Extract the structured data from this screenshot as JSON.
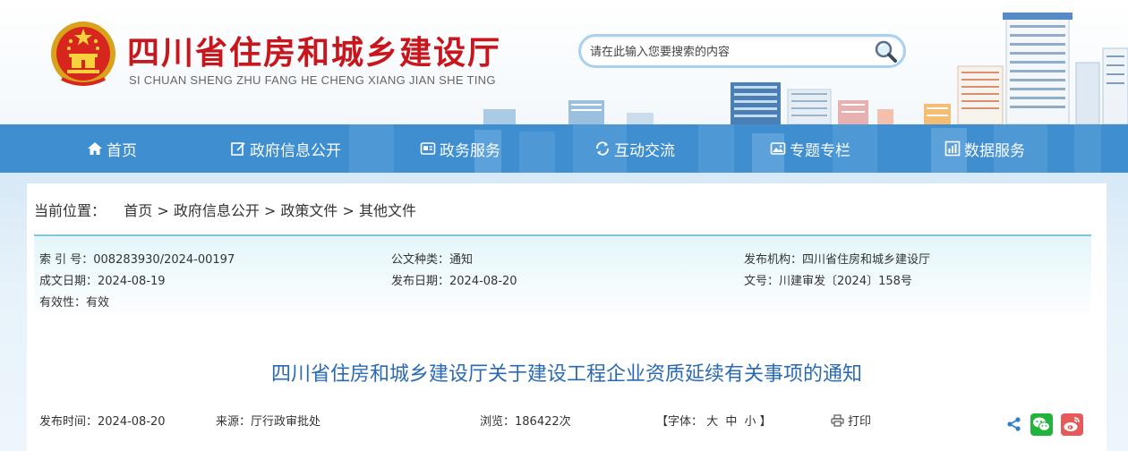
{
  "header": {
    "title": "四川省住房和城乡建设厅",
    "pinyin": "SI CHUAN SHENG ZHU FANG HE CHENG XIANG JIAN SHE TING",
    "search_placeholder": "请在此输入您要搜索的内容"
  },
  "nav": [
    {
      "label": "首页",
      "icon": "home-icon"
    },
    {
      "label": "政府信息公开",
      "icon": "edit-icon"
    },
    {
      "label": "政务服务",
      "icon": "service-icon"
    },
    {
      "label": "互动交流",
      "icon": "exchange-icon"
    },
    {
      "label": "专题专栏",
      "icon": "image-icon"
    },
    {
      "label": "数据服务",
      "icon": "chart-icon"
    }
  ],
  "breadcrumb": {
    "prefix": "当前位置：",
    "items": [
      "首页",
      "政府信息公开",
      "政策文件",
      "其他文件"
    ],
    "sep": ">"
  },
  "meta": {
    "index_no": "索 引 号：008283930/2024-00197",
    "category": "公文种类：通知",
    "publisher": "发布机构：四川省住房和城乡建设厅",
    "created": "成文日期：2024-08-19",
    "published": "发布日期：2024-08-20",
    "doc_no": "文号：川建审发〔2024〕158号",
    "validity": "有效性：有效"
  },
  "article": {
    "title": "四川省住房和城乡建设厅关于建设工程企业资质延续有关事项的通知",
    "publish_time": "发布时间：2024-08-20",
    "source": "来源：厅行政审批处",
    "views": "浏览：186422次",
    "font_prefix": "【字体：",
    "font_large": "大",
    "font_medium": "中",
    "font_small": "小",
    "font_suffix": "】",
    "print": "打印"
  },
  "colors": {
    "brand_red": "#c8161d",
    "nav_blue": "#3e8ed0",
    "title_blue": "#2a6ab5",
    "wechat_green": "#21b33b",
    "weibo_red": "#e85a5a"
  }
}
